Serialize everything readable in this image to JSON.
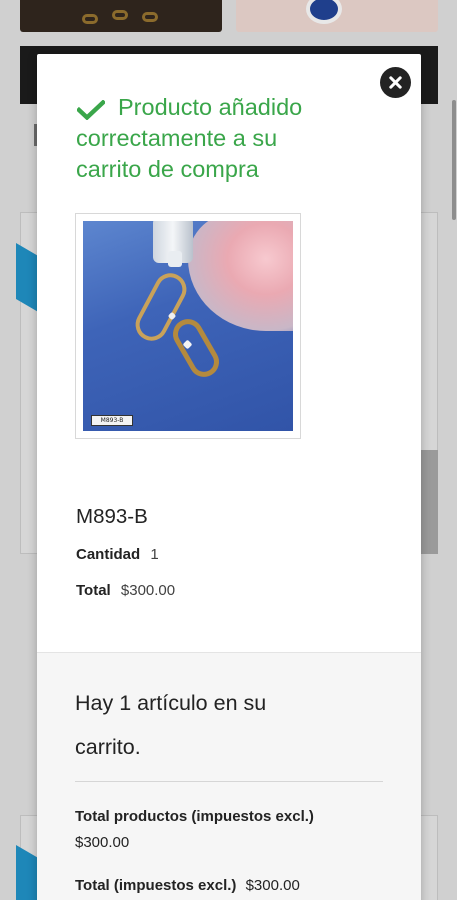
{
  "modal": {
    "confirmation_line1": "Producto añadido",
    "confirmation_rest": [
      "correctamente a su",
      "carrito de compra"
    ],
    "product": {
      "name": "M893-B",
      "image_label": "M893-B",
      "quantity_label": "Cantidad",
      "quantity_value": "1",
      "total_label": "Total",
      "total_value": "$300.00"
    },
    "summary": {
      "cart_count_text": "Hay 1 artículo en su carrito.",
      "products_total_label": "Total productos (impuestos excl.)",
      "products_total_value": "$300.00",
      "total_label": "Total (impuestos excl.)",
      "total_value": "$300.00"
    }
  },
  "colors": {
    "success": "#3aa64a",
    "close_button": "#232323",
    "overlay_background": "#d0d0d0"
  },
  "icons": {
    "confirmation": "check-icon",
    "close": "close-icon"
  }
}
